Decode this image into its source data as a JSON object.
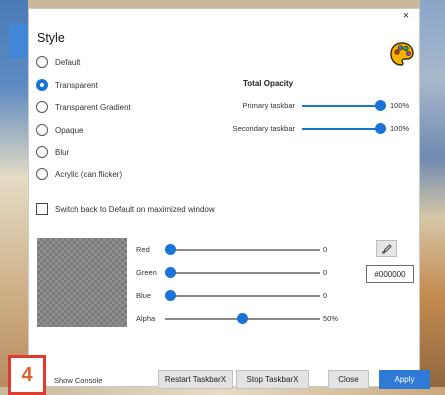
{
  "window": {
    "close_glyph": "×",
    "title": "Style",
    "palette_icon": "palette-icon"
  },
  "style_options": [
    {
      "label": "Default",
      "checked": false
    },
    {
      "label": "Transparent",
      "checked": true
    },
    {
      "label": "Transparent Gradient",
      "checked": false
    },
    {
      "label": "Opaque",
      "checked": false
    },
    {
      "label": "Blur",
      "checked": false
    },
    {
      "label": "Acrylic (can flicker)",
      "checked": false
    }
  ],
  "opacity": {
    "heading": "Total Opacity",
    "primary": {
      "label": "Primary taskbar",
      "value_text": "100%",
      "level": 1.0
    },
    "secondary": {
      "label": "Secondary taskbar",
      "value_text": "100%",
      "level": 1.0
    }
  },
  "switch_default": {
    "label": "Switch back to Default on maximized window",
    "checked": false
  },
  "color": {
    "red": {
      "label": "Red",
      "value_text": "0",
      "level": 0.0
    },
    "green": {
      "label": "Green",
      "value_text": "0",
      "level": 0.0
    },
    "blue": {
      "label": "Blue",
      "value_text": "0",
      "level": 0.0
    },
    "alpha": {
      "label": "Alpha",
      "value_text": "50%",
      "level": 0.5
    },
    "hex": "#000000",
    "picker_icon": "eyedropper-icon"
  },
  "footer": {
    "show_console": "Show Console",
    "restart": "Restart TaskbarX",
    "stop": "Stop TaskbarX",
    "close": "Close",
    "apply": "Apply"
  },
  "annotation": {
    "step": "4"
  },
  "colors": {
    "accent": "#1a73d6",
    "apply_button": "#2f7ad6",
    "badge_border": "#e03a2e"
  }
}
